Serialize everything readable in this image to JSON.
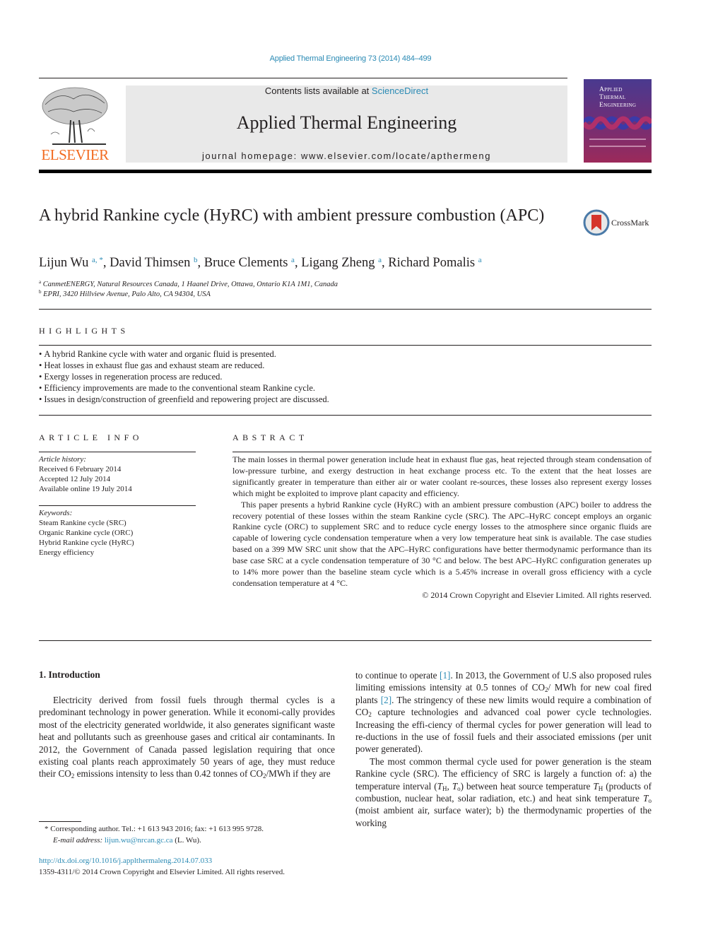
{
  "header": {
    "citation": "Applied Thermal Engineering 73 (2014) 484–499",
    "contents_prefix": "Contents lists available at ",
    "contents_link": "ScienceDirect",
    "journal_title": "Applied Thermal Engineering",
    "homepage": "journal homepage: www.elsevier.com/locate/apthermeng",
    "publisher_logo_text": "ELSEVIER",
    "cover_title_lines": [
      "Applied",
      "Thermal",
      "Engineering"
    ],
    "crossmark_label": "CrossMark",
    "colors": {
      "link": "#2a8ab4",
      "elsevier_orange": "#f26b21",
      "masthead_bg": "#e9e9e9"
    }
  },
  "article": {
    "title": "A hybrid Rankine cycle (HyRC) with ambient pressure combustion (APC)",
    "authors": [
      {
        "name": "Lijun Wu",
        "sup": "a, *"
      },
      {
        "name": "David Thimsen",
        "sup": "b"
      },
      {
        "name": "Bruce Clements",
        "sup": "a"
      },
      {
        "name": "Ligang Zheng",
        "sup": "a"
      },
      {
        "name": "Richard Pomalis",
        "sup": "a"
      }
    ],
    "affiliations": [
      {
        "key": "a",
        "text": "CanmetENERGY, Natural Resources Canada, 1 Haanel Drive, Ottawa, Ontario K1A 1M1, Canada"
      },
      {
        "key": "b",
        "text": "EPRI, 3420 Hillview Avenue, Palo Alto, CA 94304, USA"
      }
    ]
  },
  "highlights": {
    "heading": "HIGHLIGHTS",
    "items": [
      "A hybrid Rankine cycle with water and organic fluid is presented.",
      "Heat losses in exhaust flue gas and exhaust steam are reduced.",
      "Exergy losses in regeneration process are reduced.",
      "Efficiency improvements are made to the conventional steam Rankine cycle.",
      "Issues in design/construction of greenfield and repowering project are discussed."
    ]
  },
  "article_info": {
    "heading": "ARTICLE INFO",
    "history_label": "Article history:",
    "history": [
      "Received 6 February 2014",
      "Accepted 12 July 2014",
      "Available online 19 July 2014"
    ],
    "keywords_label": "Keywords:",
    "keywords": [
      "Steam Rankine cycle (SRC)",
      "Organic Rankine cycle (ORC)",
      "Hybrid Rankine cycle (HyRC)",
      "Energy efficiency"
    ]
  },
  "abstract": {
    "heading": "ABSTRACT",
    "paragraphs": [
      "The main losses in thermal power generation include heat in exhaust flue gas, heat rejected through steam condensation of low-pressure turbine, and exergy destruction in heat exchange process etc. To the extent that the heat losses are significantly greater in temperature than either air or water coolant re-sources, these losses also represent exergy losses which might be exploited to improve plant capacity and efficiency.",
      "This paper presents a hybrid Rankine cycle (HyRC) with an ambient pressure combustion (APC) boiler to address the recovery potential of these losses within the steam Rankine cycle (SRC). The APC–HyRC concept employs an organic Rankine cycle (ORC) to supplement SRC and to reduce cycle energy losses to the atmosphere since organic fluids are capable of lowering cycle condensation temperature when a very low temperature heat sink is available. The case studies based on a 399 MW SRC unit show that the APC–HyRC configurations have better thermodynamic performance than its base case SRC at a cycle condensation temperature of 30 °C and below. The best APC–HyRC configuration generates up to 14% more power than the baseline steam cycle which is a 5.45% increase in overall gross efficiency with a cycle condensation temperature at 4 °C."
    ],
    "copyright": "© 2014 Crown Copyright and Elsevier Limited. All rights reserved."
  },
  "body": {
    "section_heading": "1.  Introduction",
    "left_paragraph": {
      "text_1": "Electricity derived from fossil fuels through thermal cycles is a predominant technology in power generation. While it economi-cally provides most of the electricity generated worldwide, it also generates significant waste heat and pollutants such as greenhouse gases and critical air contaminants. In 2012, the Government of Canada passed legislation requiring that once existing coal plants reach approximately 50 years of age, they must reduce their CO",
      "text_2": " emissions intensity to less than 0.42 tonnes of CO",
      "text_3": "/MWh if they are"
    },
    "right_paragraph_1": {
      "t1": "to continue to operate ",
      "ref1": "[1]",
      "t2": ". In 2013, the Government of U.S also proposed rules limiting emissions intensity at 0.5 tonnes of CO",
      "t3": "/ MWh for new coal fired plants ",
      "ref2": "[2]",
      "t4": ". The stringency of these new limits would require a combination of CO",
      "t5": " capture technologies and advanced coal power cycle technologies. Increasing the effi-ciency of thermal cycles for power generation will lead to re-ductions in the use of fossil fuels and their associated emissions (per unit power generated)."
    },
    "right_paragraph_2": {
      "t1": "The most common thermal cycle used for power generation is the steam Rankine cycle (SRC). The efficiency of SRC is largely a function of: a) the temperature interval (",
      "t2": ", ",
      "t3": ") between heat source temperature ",
      "t4": " (products of combustion, nuclear heat, solar radiation, etc.) and heat sink temperature ",
      "t5": " (moist ambient air, surface water); b) the thermodynamic properties of the working",
      "T": "T",
      "sub_H": "H",
      "sub_o": "o"
    },
    "sub_2": "2"
  },
  "footnotes": {
    "corresponding": "* Corresponding author. Tel.: +1 613 943 2016; fax: +1 613 995 9728.",
    "email_label": "E-mail address: ",
    "email": "lijun.wu@nrcan.gc.ca",
    "email_suffix": " (L. Wu).",
    "doi": "http://dx.doi.org/10.1016/j.applthermaleng.2014.07.033",
    "issn_line": "1359-4311/© 2014 Crown Copyright and Elsevier Limited. All rights reserved."
  }
}
